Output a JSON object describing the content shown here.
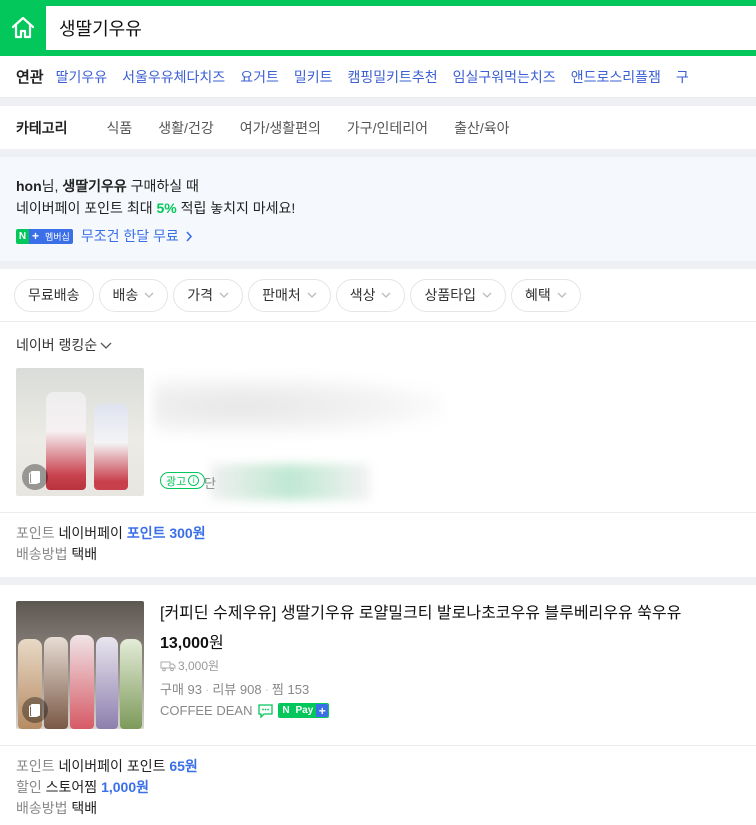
{
  "search": {
    "query": "생딸기우유"
  },
  "related": {
    "title": "연관",
    "items": [
      "딸기우유",
      "서울우유체다치즈",
      "요거트",
      "밀키트",
      "캠핑밀키트추천",
      "임실구워먹는치즈",
      "앤드로스리플잼",
      "구"
    ]
  },
  "category": {
    "title": "카테고리",
    "items": [
      "식품",
      "생활/건강",
      "여가/생활편의",
      "가구/인테리어",
      "출산/육아"
    ]
  },
  "promo": {
    "user": "hon",
    "line1_mid": "님, ",
    "query": "생딸기우유",
    "line1_end": " 구매하실 때",
    "line2_start": "네이버페이 포인트 최대 ",
    "percent": "5%",
    "line2_end": " 적립 놓치지 마세요!",
    "badge_n": "N",
    "badge_plus": "+",
    "badge_member": "멤버십",
    "link": "무조건 한달 무료"
  },
  "filters": [
    {
      "label": "무료배송",
      "chevron": false
    },
    {
      "label": "배송",
      "chevron": true
    },
    {
      "label": "가격",
      "chevron": true
    },
    {
      "label": "판매처",
      "chevron": true
    },
    {
      "label": "색상",
      "chevron": true
    },
    {
      "label": "상품타입",
      "chevron": true
    },
    {
      "label": "혜택",
      "chevron": true
    }
  ],
  "sort": {
    "label": "네이버 랭킹순"
  },
  "products": [
    {
      "ad_label": "광고",
      "ad_info": "i",
      "ad_trailing": "단",
      "meta": {
        "point_key": "포인트",
        "point_value": "네이버페이",
        "point_highlight": "포인트 300원",
        "shipping_key": "배송방법",
        "shipping_value": "택배"
      }
    },
    {
      "title": "[커피딘 수제우유] 생딸기우유 로얄밀크티 발로나초코우유 블루베리우유 쑥우유",
      "price": "13,000",
      "price_unit": "원",
      "shipping_fee": "3,000원",
      "purchases": "구매 93",
      "reviews": "리뷰 908",
      "likes": "찜 153",
      "store": "COFFEE DEAN",
      "pay_n": "N",
      "pay_label": "Pay",
      "pay_plus": "+",
      "meta": {
        "point_key": "포인트",
        "point_value": "네이버페이 포인트",
        "point_highlight": "65원",
        "discount_key": "할인",
        "discount_value": "스토어찜",
        "discount_highlight": "1,000원",
        "shipping_key": "배송방법",
        "shipping_value": "택배"
      }
    }
  ],
  "colors": {
    "brand_green": "#03c75a",
    "link_blue": "#3b5fd4",
    "pay_blue": "#3a6fe8"
  }
}
